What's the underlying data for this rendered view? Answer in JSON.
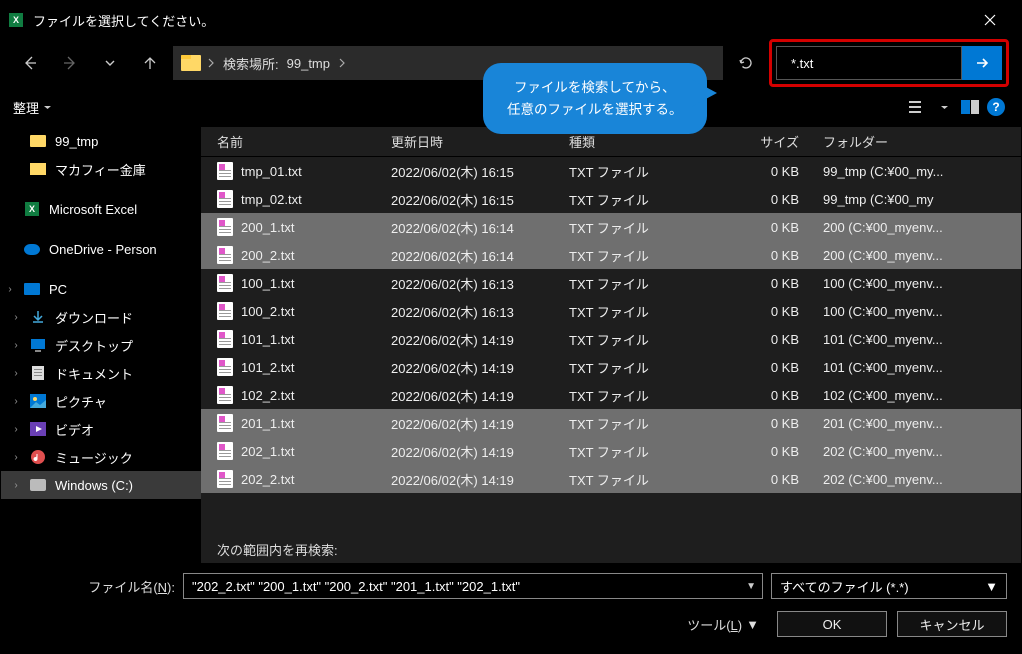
{
  "window": {
    "title": "ファイルを選択してください。"
  },
  "nav": {
    "path_label": "検索場所:",
    "path_location": "99_tmp"
  },
  "callout": {
    "line1": "ファイルを検索してから、",
    "line2": "任意のファイルを選択する。"
  },
  "search": {
    "value": "*.txt"
  },
  "toolbar": {
    "organize": "整理"
  },
  "sidebar": {
    "items": [
      {
        "label": "99_tmp",
        "icon": "folder",
        "indent": "deep"
      },
      {
        "label": "マカフィー金庫",
        "icon": "safe",
        "indent": "deep"
      },
      {
        "label": "Microsoft Excel",
        "icon": "excel",
        "indent": "shallow",
        "gap_before": true
      },
      {
        "label": "OneDrive - Person",
        "icon": "onedrive",
        "indent": "shallow",
        "gap_before": true
      },
      {
        "label": "PC",
        "icon": "pc",
        "indent": "shallow",
        "caret": true,
        "gap_before": true
      },
      {
        "label": "ダウンロード",
        "icon": "download",
        "indent": "deep",
        "caret": true
      },
      {
        "label": "デスクトップ",
        "icon": "desktop",
        "indent": "deep",
        "caret": true
      },
      {
        "label": "ドキュメント",
        "icon": "doc",
        "indent": "deep",
        "caret": true
      },
      {
        "label": "ピクチャ",
        "icon": "pic",
        "indent": "deep",
        "caret": true
      },
      {
        "label": "ビデオ",
        "icon": "video",
        "indent": "deep",
        "caret": true
      },
      {
        "label": "ミュージック",
        "icon": "music",
        "indent": "deep",
        "caret": true
      },
      {
        "label": "Windows (C:)",
        "icon": "disk",
        "indent": "deep",
        "caret": true,
        "sel": true
      }
    ]
  },
  "columns": {
    "name": "名前",
    "date": "更新日時",
    "type": "種類",
    "size": "サイズ",
    "folder": "フォルダー"
  },
  "rows": [
    {
      "name": "tmp_01.txt",
      "date": "2022/06/02(木) 16:15",
      "type": "TXT ファイル",
      "size": "0 KB",
      "folder": "99_tmp (C:¥00_my...",
      "sel": false
    },
    {
      "name": "tmp_02.txt",
      "date": "2022/06/02(木) 16:15",
      "type": "TXT ファイル",
      "size": "0 KB",
      "folder": "99_tmp (C:¥00_my",
      "sel": false
    },
    {
      "name": "200_1.txt",
      "date": "2022/06/02(木) 16:14",
      "type": "TXT ファイル",
      "size": "0 KB",
      "folder": "200 (C:¥00_myenv...",
      "sel": true
    },
    {
      "name": "200_2.txt",
      "date": "2022/06/02(木) 16:14",
      "type": "TXT ファイル",
      "size": "0 KB",
      "folder": "200 (C:¥00_myenv...",
      "sel": true
    },
    {
      "name": "100_1.txt",
      "date": "2022/06/02(木) 16:13",
      "type": "TXT ファイル",
      "size": "0 KB",
      "folder": "100 (C:¥00_myenv...",
      "sel": false
    },
    {
      "name": "100_2.txt",
      "date": "2022/06/02(木) 16:13",
      "type": "TXT ファイル",
      "size": "0 KB",
      "folder": "100 (C:¥00_myenv...",
      "sel": false
    },
    {
      "name": "101_1.txt",
      "date": "2022/06/02(木) 14:19",
      "type": "TXT ファイル",
      "size": "0 KB",
      "folder": "101 (C:¥00_myenv...",
      "sel": false
    },
    {
      "name": "101_2.txt",
      "date": "2022/06/02(木) 14:19",
      "type": "TXT ファイル",
      "size": "0 KB",
      "folder": "101 (C:¥00_myenv...",
      "sel": false
    },
    {
      "name": "102_2.txt",
      "date": "2022/06/02(木) 14:19",
      "type": "TXT ファイル",
      "size": "0 KB",
      "folder": "102 (C:¥00_myenv...",
      "sel": false
    },
    {
      "name": "201_1.txt",
      "date": "2022/06/02(木) 14:19",
      "type": "TXT ファイル",
      "size": "0 KB",
      "folder": "201 (C:¥00_myenv...",
      "sel": true
    },
    {
      "name": "202_1.txt",
      "date": "2022/06/02(木) 14:19",
      "type": "TXT ファイル",
      "size": "0 KB",
      "folder": "202 (C:¥00_myenv...",
      "sel": true
    },
    {
      "name": "202_2.txt",
      "date": "2022/06/02(木) 14:19",
      "type": "TXT ファイル",
      "size": "0 KB",
      "folder": "202 (C:¥00_myenv...",
      "sel": true
    }
  ],
  "search_again": "次の範囲内を再検索:",
  "footer": {
    "filename_label": "ファイル名(N):",
    "filename_value": "\"202_2.txt\" \"200_1.txt\" \"200_2.txt\" \"201_1.txt\" \"202_1.txt\"",
    "filter": "すべてのファイル (*.*)",
    "tools": "ツール(L)",
    "open": "OK",
    "cancel": "キャンセル"
  }
}
